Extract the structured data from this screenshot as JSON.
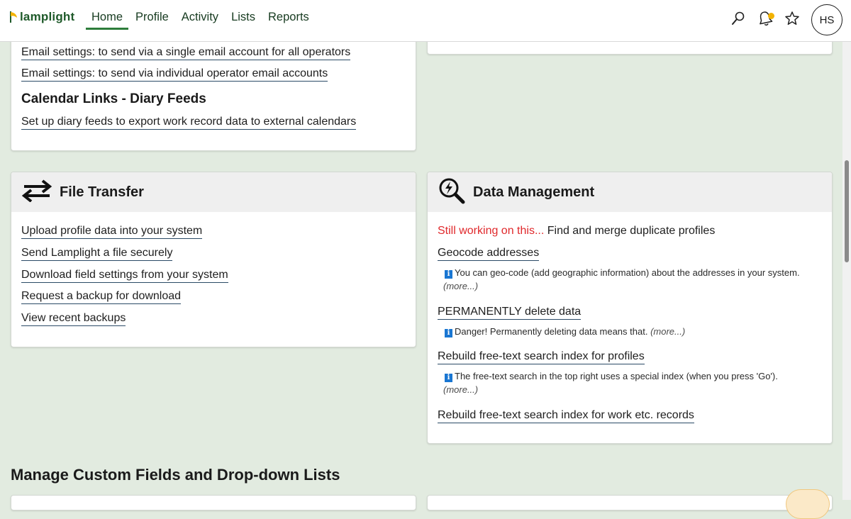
{
  "app": {
    "logo_text": "lamplight"
  },
  "nav": {
    "items": [
      "Home",
      "Profile",
      "Activity",
      "Lists",
      "Reports"
    ],
    "active": "Home"
  },
  "user": {
    "initials": "HS"
  },
  "colors": {
    "accent": "#2d7d3b",
    "warning": "#e0282b",
    "background": "#e2ebe0",
    "notification_dot": "#f2b200"
  },
  "email_card": {
    "link_single": "Email settings: to send via a single email account for all operators",
    "link_individual": "Email settings: to send via individual operator email accounts",
    "calendar_heading": "Calendar Links - Diary Feeds",
    "calendar_link": "Set up diary feeds to export work record data to external calendars"
  },
  "file_transfer": {
    "icon": "transfer-arrows-icon",
    "title": "File Transfer",
    "links": [
      "Upload profile data into your system",
      "Send Lamplight a file securely",
      "Download field settings from your system",
      "Request a backup for download",
      "View recent backups"
    ]
  },
  "data_management": {
    "icon": "data-search-icon",
    "title": "Data Management",
    "wip_label": "Still working on this...",
    "wip_text": "Find and merge duplicate profiles",
    "geocode_link": "Geocode addresses",
    "geocode_note": "You can geo-code (add geographic information) about the addresses in your system.",
    "delete_link": "PERMANENTLY delete data",
    "delete_note": "Danger! Permanently deleting data means that.",
    "rebuild_profiles_link": "Rebuild free-text search index for profiles",
    "rebuild_profiles_note": "The free-text search in the top right uses a special index (when you press 'Go').",
    "rebuild_records_link": "Rebuild free-text search index for work etc. records",
    "more_label": "(more...)"
  },
  "section": {
    "title": "Manage Custom Fields and Drop-down Lists"
  }
}
